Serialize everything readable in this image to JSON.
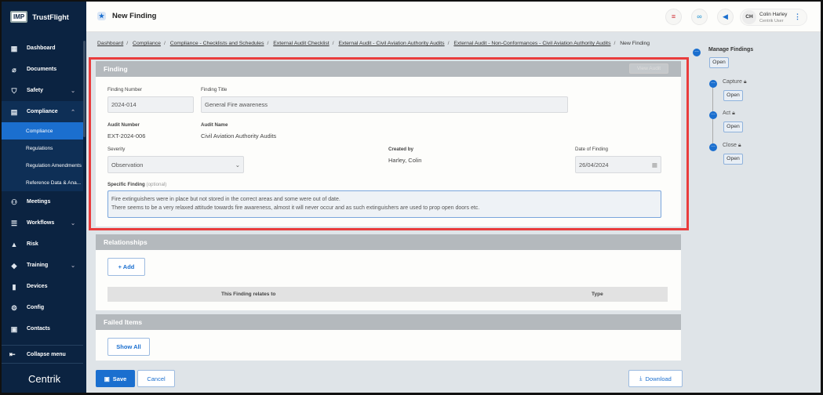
{
  "app": {
    "brand_badge": "IMP",
    "brand": "TrustFlight",
    "footer_logo": "Centrik"
  },
  "sidebar": {
    "items": [
      {
        "label": "Dashboard",
        "icon": "dashboard-icon"
      },
      {
        "label": "Documents",
        "icon": "paperclip-icon"
      },
      {
        "label": "Safety",
        "icon": "shield-icon"
      },
      {
        "label": "Compliance",
        "icon": "compliance-icon"
      },
      {
        "label": "Meetings",
        "icon": "meetings-icon"
      },
      {
        "label": "Workflows",
        "icon": "workflows-icon"
      },
      {
        "label": "Risk",
        "icon": "risk-icon"
      },
      {
        "label": "Training",
        "icon": "training-icon"
      },
      {
        "label": "Devices",
        "icon": "devices-icon"
      },
      {
        "label": "Config",
        "icon": "config-icon"
      },
      {
        "label": "Contacts",
        "icon": "contacts-icon"
      }
    ],
    "compliance_sub": [
      "Compliance",
      "Regulations",
      "Regulation Amendments",
      "Reference Data & Ana..."
    ],
    "collapse": "Collapse menu"
  },
  "header": {
    "title": "New Finding",
    "user_initials": "CH",
    "user_name": "Colin Harley",
    "user_role": "Centrik User"
  },
  "breadcrumb": [
    "Dashboard",
    "Compliance",
    "Compliance - Checklists and Schedules",
    "External Audit Checklist",
    "External Audit - Civil Aviation Authority Audits",
    "External Audit - Non-Conformances - Civil Aviation Authority Audits",
    "New Finding"
  ],
  "finding": {
    "heading": "Finding",
    "view_audit": "View Audit",
    "finding_number_label": "Finding Number",
    "finding_number": "2024-014",
    "finding_title_label": "Finding Title",
    "finding_title": "General Fire awareness",
    "audit_number_label": "Audit Number",
    "audit_number": "EXT-2024-006",
    "audit_name_label": "Audit Name",
    "audit_name": "Civil Aviation Authority Audits",
    "severity_label": "Severity",
    "severity": "Observation",
    "created_by_label": "Created by",
    "created_by": "Harley, Colin",
    "date_label": "Date of Finding",
    "date": "26/04/2024",
    "specific_label": "Specific Finding",
    "specific_optional": "(optional)",
    "specific_line1": "Fire extinguishers were in place but not stored in the correct areas and some were out of date.",
    "specific_line2": "There seems to be a very relaxed attitude towards fire awareness, almost it will never occur and as such extinguishers are used to prop open doors etc."
  },
  "relationships": {
    "heading": "Relationships",
    "add": "+ Add",
    "col1": "This Finding relates to",
    "col2": "Type"
  },
  "failed_items": {
    "heading": "Failed Items",
    "show_all": "Show All"
  },
  "footer": {
    "save": "Save",
    "cancel": "Cancel",
    "download": "Download"
  },
  "workflow": {
    "title": "Manage Findings",
    "open": "Open",
    "steps": [
      "Capture",
      "Act",
      "Close"
    ]
  }
}
